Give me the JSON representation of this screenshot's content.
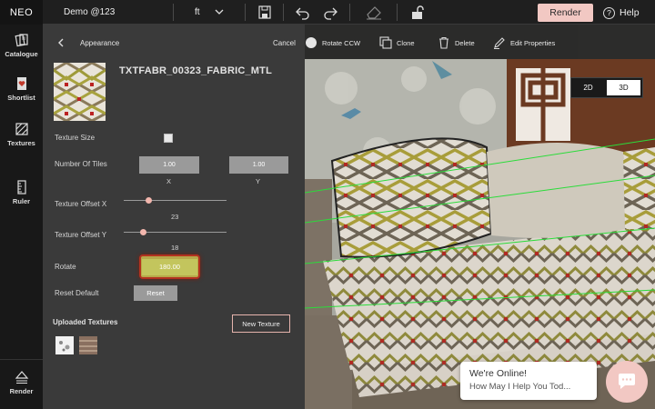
{
  "topbar": {
    "logo": "NEO",
    "project": "Demo @123",
    "unit": "ft",
    "render_label": "Render",
    "help_label": "Help"
  },
  "rail": {
    "items": [
      {
        "label": "Catalogue"
      },
      {
        "label": "Shortlist"
      },
      {
        "label": "Textures"
      },
      {
        "label": "Ruler"
      },
      {
        "label": "Render"
      }
    ]
  },
  "panel": {
    "title": "Appearance",
    "cancel_label": "Cancel",
    "material_name": "TXTFABR_00323_FABRIC_MTL",
    "texture_size_label": "Texture Size",
    "tiles_label": "Number Of Tiles",
    "tiles_x": "1.00",
    "tiles_y": "1.00",
    "x_label": "X",
    "y_label": "Y",
    "offset_x_label": "Texture Offset X",
    "offset_x_value": "23",
    "offset_y_label": "Texture Offset Y",
    "offset_y_value": "18",
    "rotate_label": "Rotate",
    "rotate_value": "180.00",
    "reset_default_label": "Reset Default",
    "reset_label": "Reset",
    "uploaded_label": "Uploaded Textures",
    "new_texture_label": "New Texture"
  },
  "viewport": {
    "tools": [
      {
        "label": "Rotate CCW"
      },
      {
        "label": "Clone"
      },
      {
        "label": "Delete"
      },
      {
        "label": "Edit Properties"
      }
    ],
    "view_2d": "2D",
    "view_3d": "3D",
    "active_view": "3D"
  },
  "chat": {
    "title": "We're Online!",
    "subtitle": "How May I Help You Tod..."
  },
  "colors": {
    "accent": "#f2c8c3",
    "rotate_highlight": "#b3321f",
    "panel_bg": "#3a3a3a",
    "rail_bg": "#181818"
  }
}
